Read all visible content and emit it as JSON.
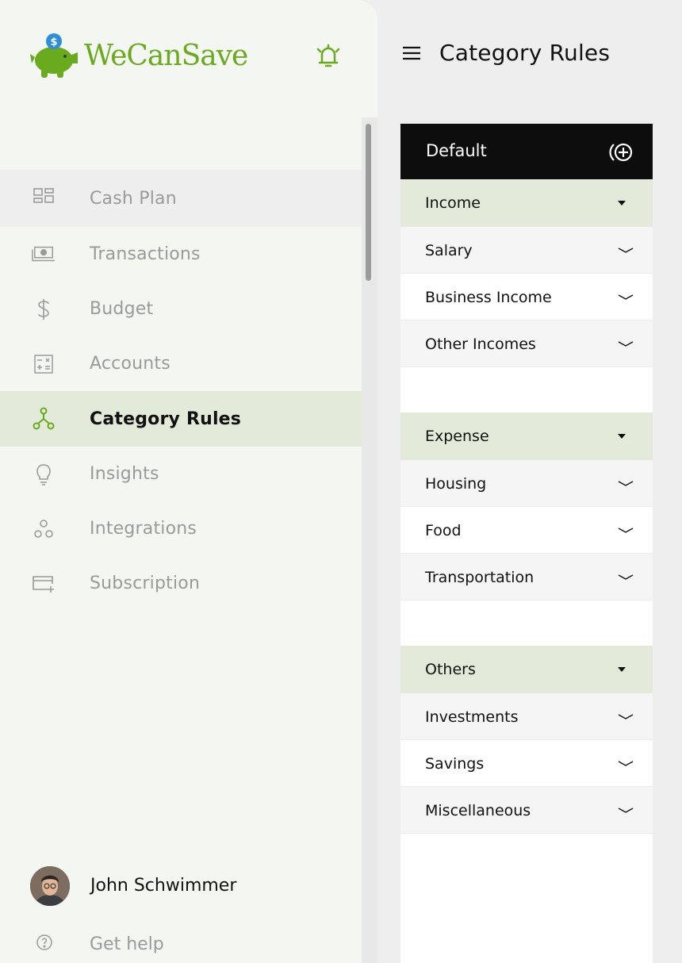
{
  "app": {
    "name": "WeCanSave"
  },
  "colors": {
    "brand": "#6aaa1f",
    "active_bg": "#e3ead9",
    "header_bg": "#0d0d0d"
  },
  "sidebar": {
    "items": [
      {
        "label": "Cash Plan",
        "icon": "grid-icon",
        "state": "hover"
      },
      {
        "label": "Transactions",
        "icon": "cash-icon"
      },
      {
        "label": "Budget",
        "icon": "dollar-icon"
      },
      {
        "label": "Accounts",
        "icon": "calculator-icon"
      },
      {
        "label": "Category Rules",
        "icon": "branch-icon",
        "state": "active"
      },
      {
        "label": "Insights",
        "icon": "lightbulb-icon"
      },
      {
        "label": "Integrations",
        "icon": "circles-icon"
      },
      {
        "label": "Subscription",
        "icon": "card-plus-icon"
      }
    ],
    "user": {
      "name": "John Schwimmer"
    },
    "help": {
      "label": "Get help"
    }
  },
  "header": {
    "title": "Category Rules"
  },
  "panel": {
    "title": "Default",
    "groups": [
      {
        "label": "Income",
        "items": [
          "Salary",
          "Business Income",
          "Other Incomes"
        ]
      },
      {
        "label": "Expense",
        "items": [
          "Housing",
          "Food",
          "Transportation"
        ]
      },
      {
        "label": "Others",
        "items": [
          "Investments",
          "Savings",
          "Miscellaneous"
        ]
      }
    ]
  }
}
